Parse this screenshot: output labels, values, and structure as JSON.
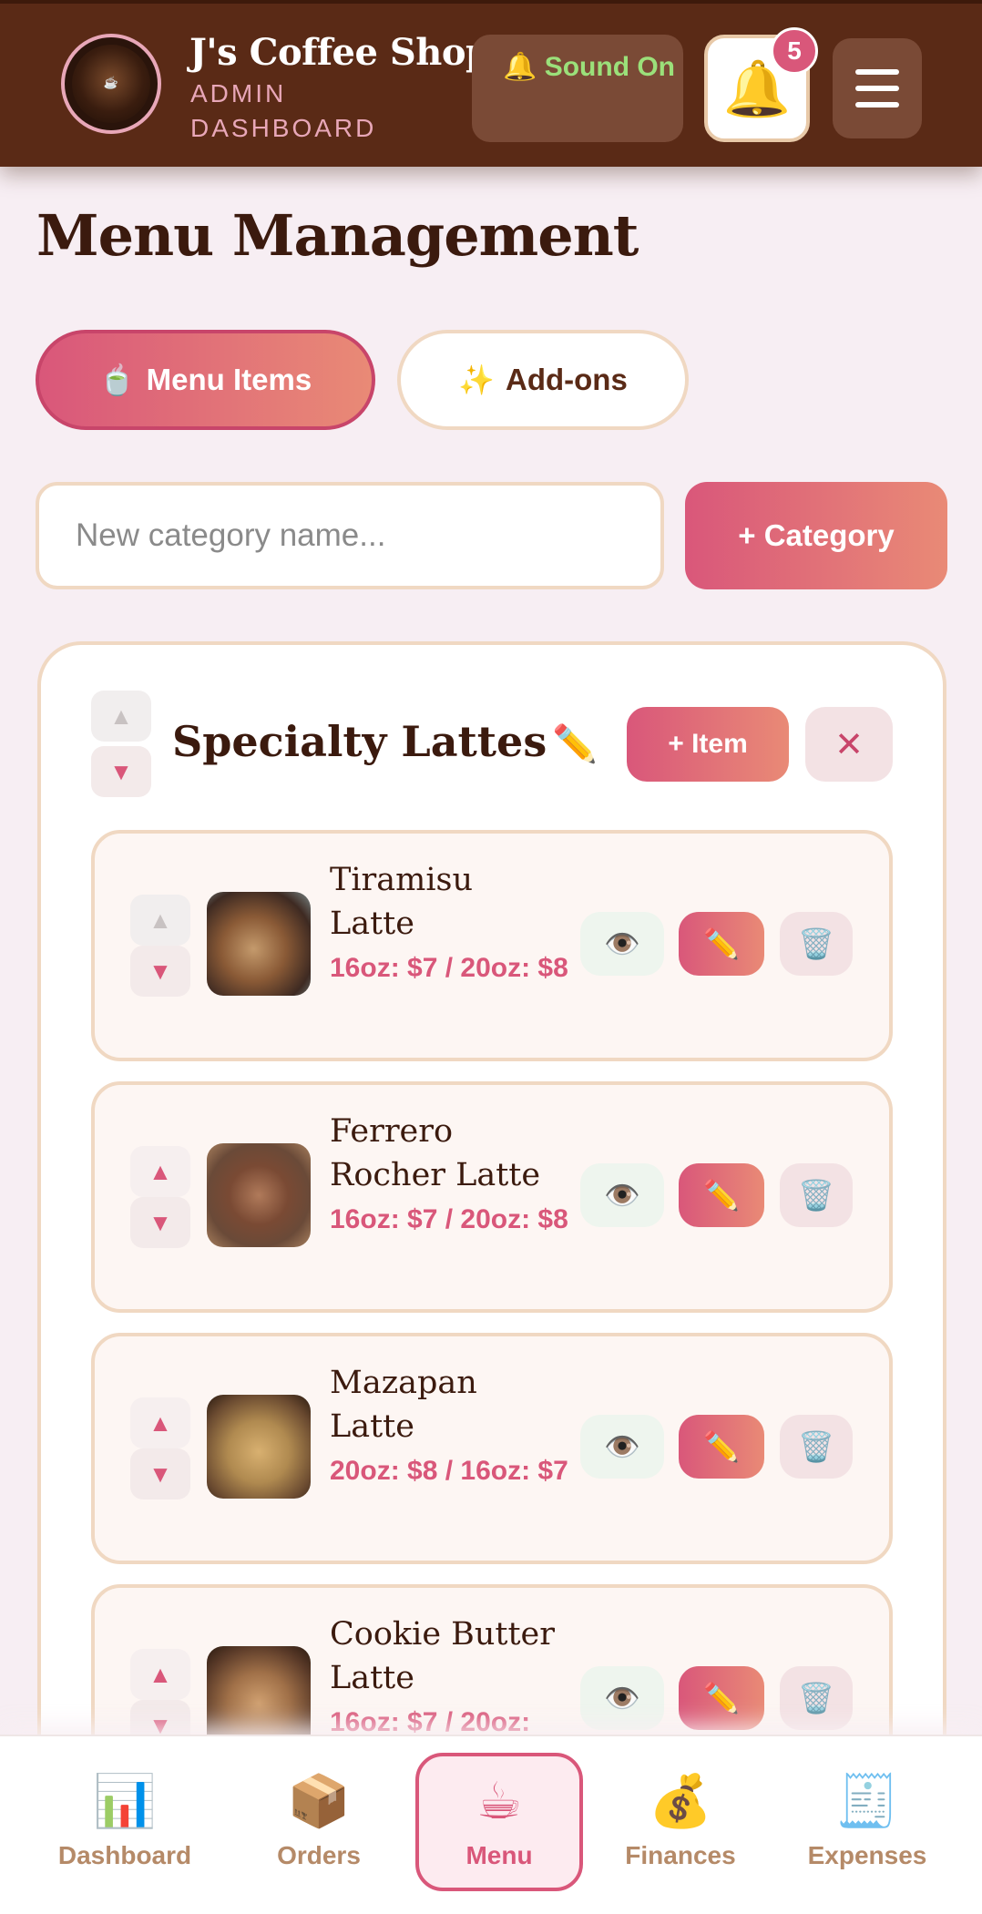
{
  "header": {
    "logo_text": "J's Coffee Shop",
    "title": "J's Coffee Shop",
    "subtitle": "ADMIN DASHBOARD",
    "sound_button": {
      "icon": "🔔",
      "label": "Sound On"
    },
    "notifications": {
      "icon": "🔔",
      "count": "5"
    }
  },
  "page": {
    "title": "Menu Management",
    "tabs": [
      {
        "icon": "🍵",
        "label": "Menu Items",
        "active": true
      },
      {
        "icon": "✨",
        "label": "Add-ons",
        "active": false
      }
    ],
    "new_category": {
      "placeholder": "New category name...",
      "value": "",
      "button": "+ Category"
    }
  },
  "category": {
    "name": "Specialty Lattes",
    "edit_icon": "✏️",
    "add_item_button": "+ Item",
    "delete_icon": "✕",
    "up_icon": "▲",
    "down_icon": "▼",
    "items": [
      {
        "name": "Tiramisu Latte",
        "price": "16oz: $7 / 20oz: $8"
      },
      {
        "name": "Ferrero Rocher Latte",
        "price": "16oz: $7 / 20oz: $8"
      },
      {
        "name": "Mazapan Latte",
        "price": "20oz: $8 / 16oz: $7"
      },
      {
        "name": "Cookie Butter Latte",
        "price": "16oz: $7 / 20oz:"
      }
    ]
  },
  "item_actions": {
    "view_icon": "👁️",
    "edit_icon": "✏️",
    "delete_icon": "🗑️"
  },
  "bottom_nav": [
    {
      "icon": "📊",
      "label": "Dashboard"
    },
    {
      "icon": "📦",
      "label": "Orders"
    },
    {
      "icon": "☕",
      "label": "Menu",
      "active": true
    },
    {
      "icon": "💰",
      "label": "Finances"
    },
    {
      "icon": "🧾",
      "label": "Expenses"
    }
  ],
  "colors": {
    "header": "#5a2a16",
    "accent": "#d9577a",
    "background": "#f7eef3"
  }
}
